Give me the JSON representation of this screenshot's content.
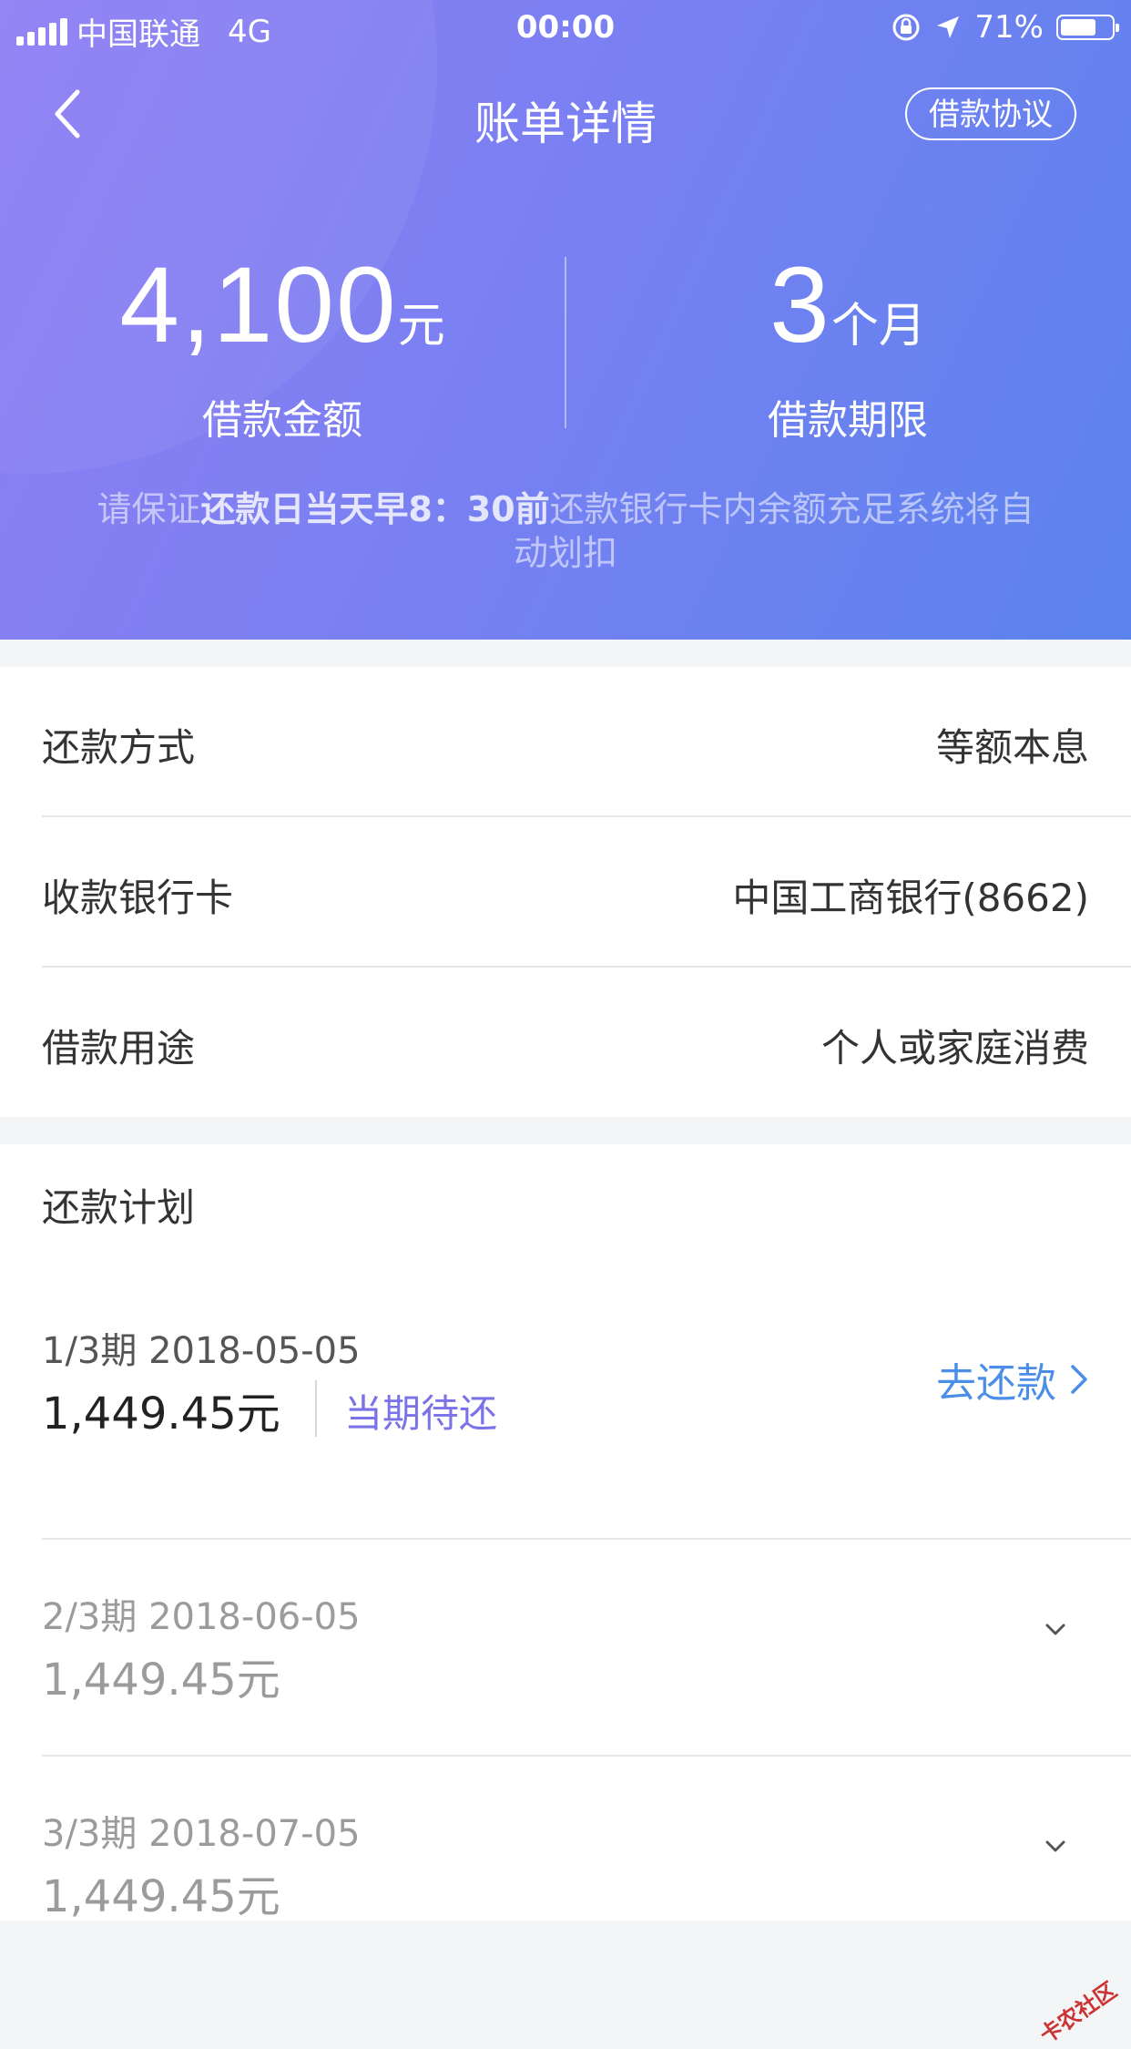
{
  "status_bar": {
    "carrier": "中国联通",
    "network": "4G",
    "time": "00:00",
    "battery": "71%",
    "battery_level": 0.71
  },
  "nav": {
    "title": "账单详情",
    "agreement_button": "借款协议"
  },
  "summary": {
    "amount_value": "4,100",
    "amount_unit": "元",
    "amount_label": "借款金额",
    "term_value": "3",
    "term_unit": "个月",
    "term_label": "借款期限"
  },
  "notice": {
    "part1": "请保证",
    "highlight": "还款日当天早8：30前",
    "part2": "还款银行卡内余额充足系统将自动划扣"
  },
  "info": [
    {
      "key": "还款方式",
      "value": "等额本息"
    },
    {
      "key": "收款银行卡",
      "value": "中国工商银行(8662)"
    },
    {
      "key": "借款用途",
      "value": "个人或家庭消费"
    }
  ],
  "plan": {
    "title": "还款计划",
    "installments": [
      {
        "period": "1/3期 2018-05-05",
        "amount": "1,449.45元",
        "status": "当期待还",
        "action": "去还款"
      },
      {
        "period": "2/3期 2018-06-05",
        "amount": "1,449.45元"
      },
      {
        "period": "3/3期 2018-07-05",
        "amount": "1,449.45元"
      }
    ]
  },
  "watermark": "卡农社区",
  "colors": {
    "header_start": "#8f7ef4",
    "header_end": "#5b83ee",
    "link_blue": "#4a8ee8",
    "status_purple": "#7a72e8"
  }
}
